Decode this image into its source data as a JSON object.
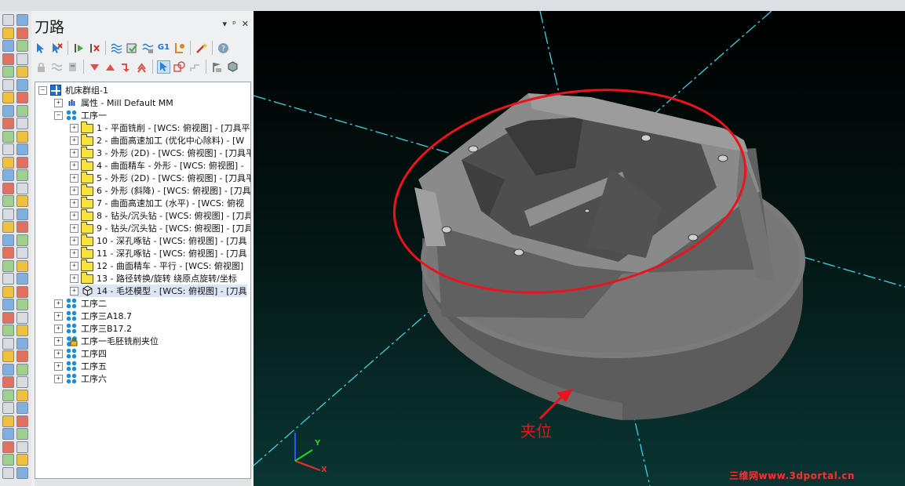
{
  "panel": {
    "title": "刀路",
    "pin_glyph": "▾",
    "dock_glyph": "ㅁ",
    "close_glyph": "✕"
  },
  "toolbar1": [
    "select-arrow",
    "deselect",
    "play",
    "delete-ops",
    "waves",
    "check",
    "layers",
    "G1",
    "wrench",
    "wand",
    "help"
  ],
  "toolbar2": [
    "lock",
    "tilde",
    "gear",
    "arrow-down",
    "arrow-up",
    "rotate",
    "shape",
    "select-arrow",
    "copy",
    "step",
    "flag",
    "cube"
  ],
  "toolbar_g1_label": "G1",
  "tree": {
    "root": "机床群组-1",
    "attribute_label": "属性 - Mill Default MM",
    "group1": "工序一",
    "ops": [
      "1 - 平面铣削 - [WCS: 俯视图] - [刀具平",
      "2 - 曲面高速加工 (优化中心除料) - [W",
      "3 - 外形 (2D) - [WCS: 俯视图] - [刀具平",
      "4 - 曲面精车 - 外形 - [WCS: 俯视图] -",
      "5 - 外形 (2D) - [WCS: 俯视图] - [刀具平",
      "6 - 外形 (斜降) - [WCS: 俯视图] - [刀具",
      "7 - 曲面高速加工 (水平) - [WCS: 俯视",
      "8 - 钻头/沉头钻 - [WCS: 俯视图] - [刀具",
      "9 - 钻头/沉头钻 - [WCS: 俯视图] - [刀具",
      "10 - 深孔啄钻 - [WCS: 俯视图] - [刀具",
      "11 - 深孔啄钻 - [WCS: 俯视图] - [刀具",
      "12 - 曲面精车 - 平行 - [WCS: 俯视图]",
      "13 - 路径转换/旋转 绕原点旋转/坐标",
      "14 - 毛坯模型 - [WCS: 俯视图] - [刀具"
    ],
    "groups": [
      "工序二",
      "工序三A18.7",
      "工序三B17.2",
      "工序一毛胚铣削夹位",
      "工序四",
      "工序五",
      "工序六"
    ]
  },
  "viewport": {
    "annotation": "夹位",
    "axis_x": "X",
    "axis_y": "Y",
    "watermark": "三维网www.3dportal.cn"
  },
  "colors": {
    "annotation": "#e8141e",
    "axis_lines": "#3fd3e3",
    "part": "#5a5a5a",
    "viewport_bg_bottom": "#0a3532"
  }
}
